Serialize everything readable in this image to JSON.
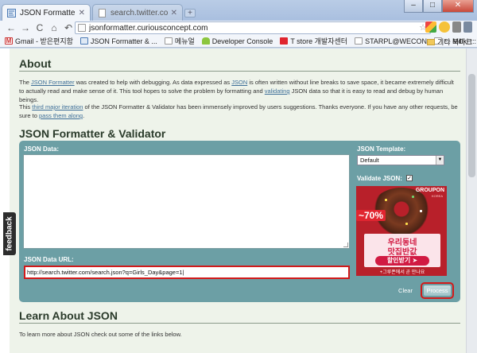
{
  "browser": {
    "tabs": [
      {
        "label": "JSON Formatter & Valid...",
        "active": true
      },
      {
        "label": "search.twitter.com/searc...",
        "active": false
      }
    ],
    "new_tab_symbol": "+",
    "window_controls": {
      "minimize": "–",
      "maximize": "□",
      "close": "✕"
    },
    "nav": {
      "back": "←",
      "forward": "→",
      "reload": "C",
      "home": "⌂",
      "history": "↶"
    },
    "address": "jsonformatter.curiousconcept.com",
    "bookmarks": [
      {
        "label": "Gmail - 받은편지함",
        "icon": "gmail-icon"
      },
      {
        "label": "JSON Formatter & ...",
        "icon": "json-formatter-icon"
      },
      {
        "label": "메뉴얼",
        "icon": "page-icon"
      },
      {
        "label": "Developer Console",
        "icon": "android-icon"
      },
      {
        "label": "T store 개발자센터",
        "icon": "tstore-icon"
      },
      {
        "label": "STARPL@WECON",
        "icon": "page-icon"
      },
      {
        "label": "::: Millki :::",
        "icon": "page-icon"
      }
    ],
    "other_bookmarks": "기타 북마크"
  },
  "feedback_tab": "feedback",
  "about": {
    "heading": "About",
    "p1": {
      "t1": "The ",
      "link1": "JSON Formatter",
      "t2": " was created to help with debugging. As data expressed as ",
      "link2": "JSON",
      "t3": " is often written without line breaks to save space, it became extremely difficult to actually read and make sense of it. This tool hopes to solve the problem by formatting and ",
      "link3": "validating",
      "t4": " JSON data so that it is easy to read and debug by human beings."
    },
    "p2": {
      "t1": "This ",
      "link1": "third major iteration",
      "t2": " of the JSON Formatter & Validator has been immensely improved by users suggestions. Thanks everyone. If you have any other requests, be sure to ",
      "link2": "pass them along",
      "t3": "."
    }
  },
  "formatter": {
    "heading": "JSON Formatter & Validator",
    "json_data_label": "JSON Data:",
    "json_data_value": "",
    "json_url_label": "JSON Data URL:",
    "json_url_value": "http://search.twitter.com/search.json?q=Girls_Day&page=1",
    "template_label": "JSON Template:",
    "template_value": "Default",
    "validate_label": "Validate JSON:",
    "validate_checked": true,
    "clear_label": "Clear",
    "process_label": "Process"
  },
  "ad": {
    "brand": "GROUPON",
    "brand_sub": "KOREA",
    "discount": "~70%",
    "line1": "우리동네",
    "line2": "맛집반값",
    "button": "할인받기 ➤",
    "footer": "+그루폰에서 곧 만나요"
  },
  "learn": {
    "heading": "Learn About JSON",
    "text": "To learn more about JSON check out some of the links below."
  },
  "colors": {
    "tool_panel": "#6c9fa5",
    "highlight": "#d11a1a",
    "link": "#3d6e98"
  }
}
